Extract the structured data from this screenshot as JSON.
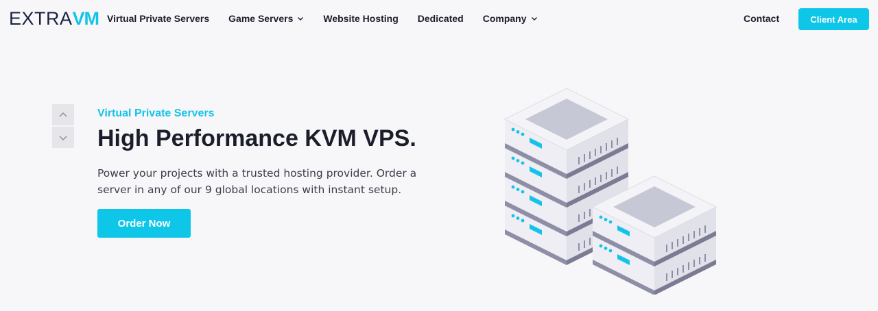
{
  "brand": {
    "logo_main": "EXTRA",
    "logo_accent": "VM",
    "accent_color": "#0ec6e8"
  },
  "nav": {
    "items": [
      {
        "label": "Virtual Private Servers",
        "has_dropdown": false
      },
      {
        "label": "Game Servers",
        "has_dropdown": true
      },
      {
        "label": "Website Hosting",
        "has_dropdown": false
      },
      {
        "label": "Dedicated",
        "has_dropdown": false
      },
      {
        "label": "Company",
        "has_dropdown": true
      }
    ],
    "contact_label": "Contact",
    "client_area_label": "Client Area"
  },
  "slider": {
    "up_icon": "chevron-up-icon",
    "down_icon": "chevron-down-icon"
  },
  "hero": {
    "eyebrow": "Virtual Private Servers",
    "title": "High Performance KVM VPS.",
    "description": "Power your projects with a trusted hosting provider. Order a server in any of our 9 global locations with instant setup.",
    "cta_label": "Order Now"
  },
  "illustration": {
    "icon": "server-stack-illustration"
  }
}
